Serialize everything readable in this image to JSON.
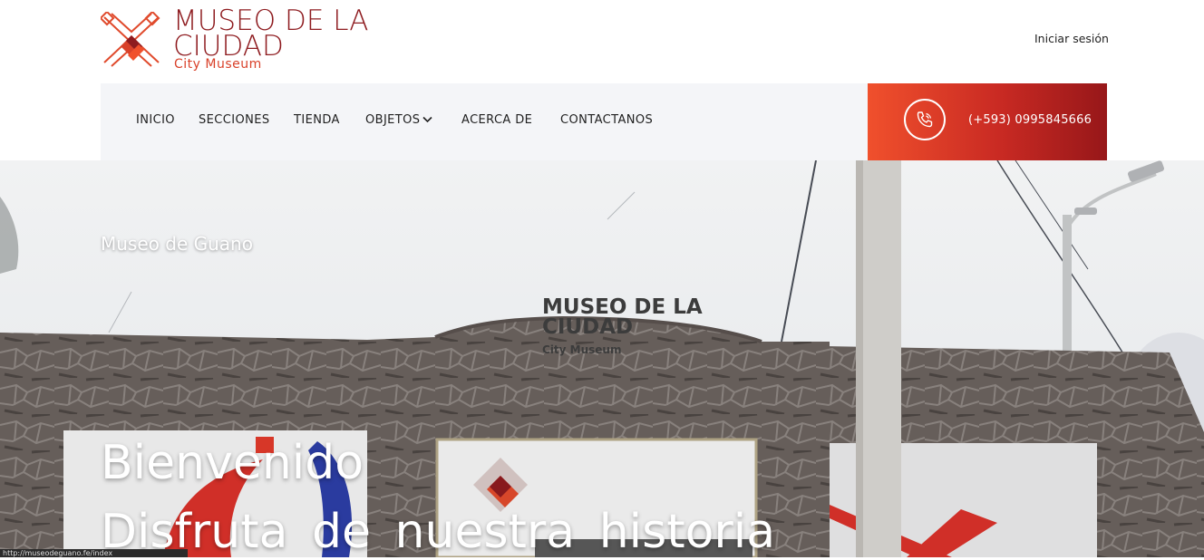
{
  "logo": {
    "title": "MUSEO DE LA CIUDAD",
    "subtitle": "City Museum"
  },
  "header": {
    "login_label": "Iniciar sesión"
  },
  "nav": {
    "items": [
      {
        "label": "INICIO"
      },
      {
        "label": "SECCIONES"
      },
      {
        "label": "TIENDA"
      },
      {
        "label": "OBJETOS"
      },
      {
        "label": "ACERCA DE"
      },
      {
        "label": "CONTACTANOS"
      }
    ],
    "dropdown_icon": "chevron-down-icon"
  },
  "contact": {
    "phone": "(+593) 0995845666",
    "icon": "phone-icon"
  },
  "hero": {
    "eyebrow": "Museo de Guano",
    "title": "Bienvenido",
    "subtitle": "Disfruta de nuestra historia",
    "sign_title": "MUSEO DE LA CIUDAD",
    "sign_subtitle": "City Museum"
  },
  "status_bar": {
    "url": "http://museodeguano.fe/index"
  },
  "colors": {
    "brand_dark_red": "#8e1b1f",
    "brand_orange": "#f0502c",
    "nav_background": "#f4f5f8"
  }
}
